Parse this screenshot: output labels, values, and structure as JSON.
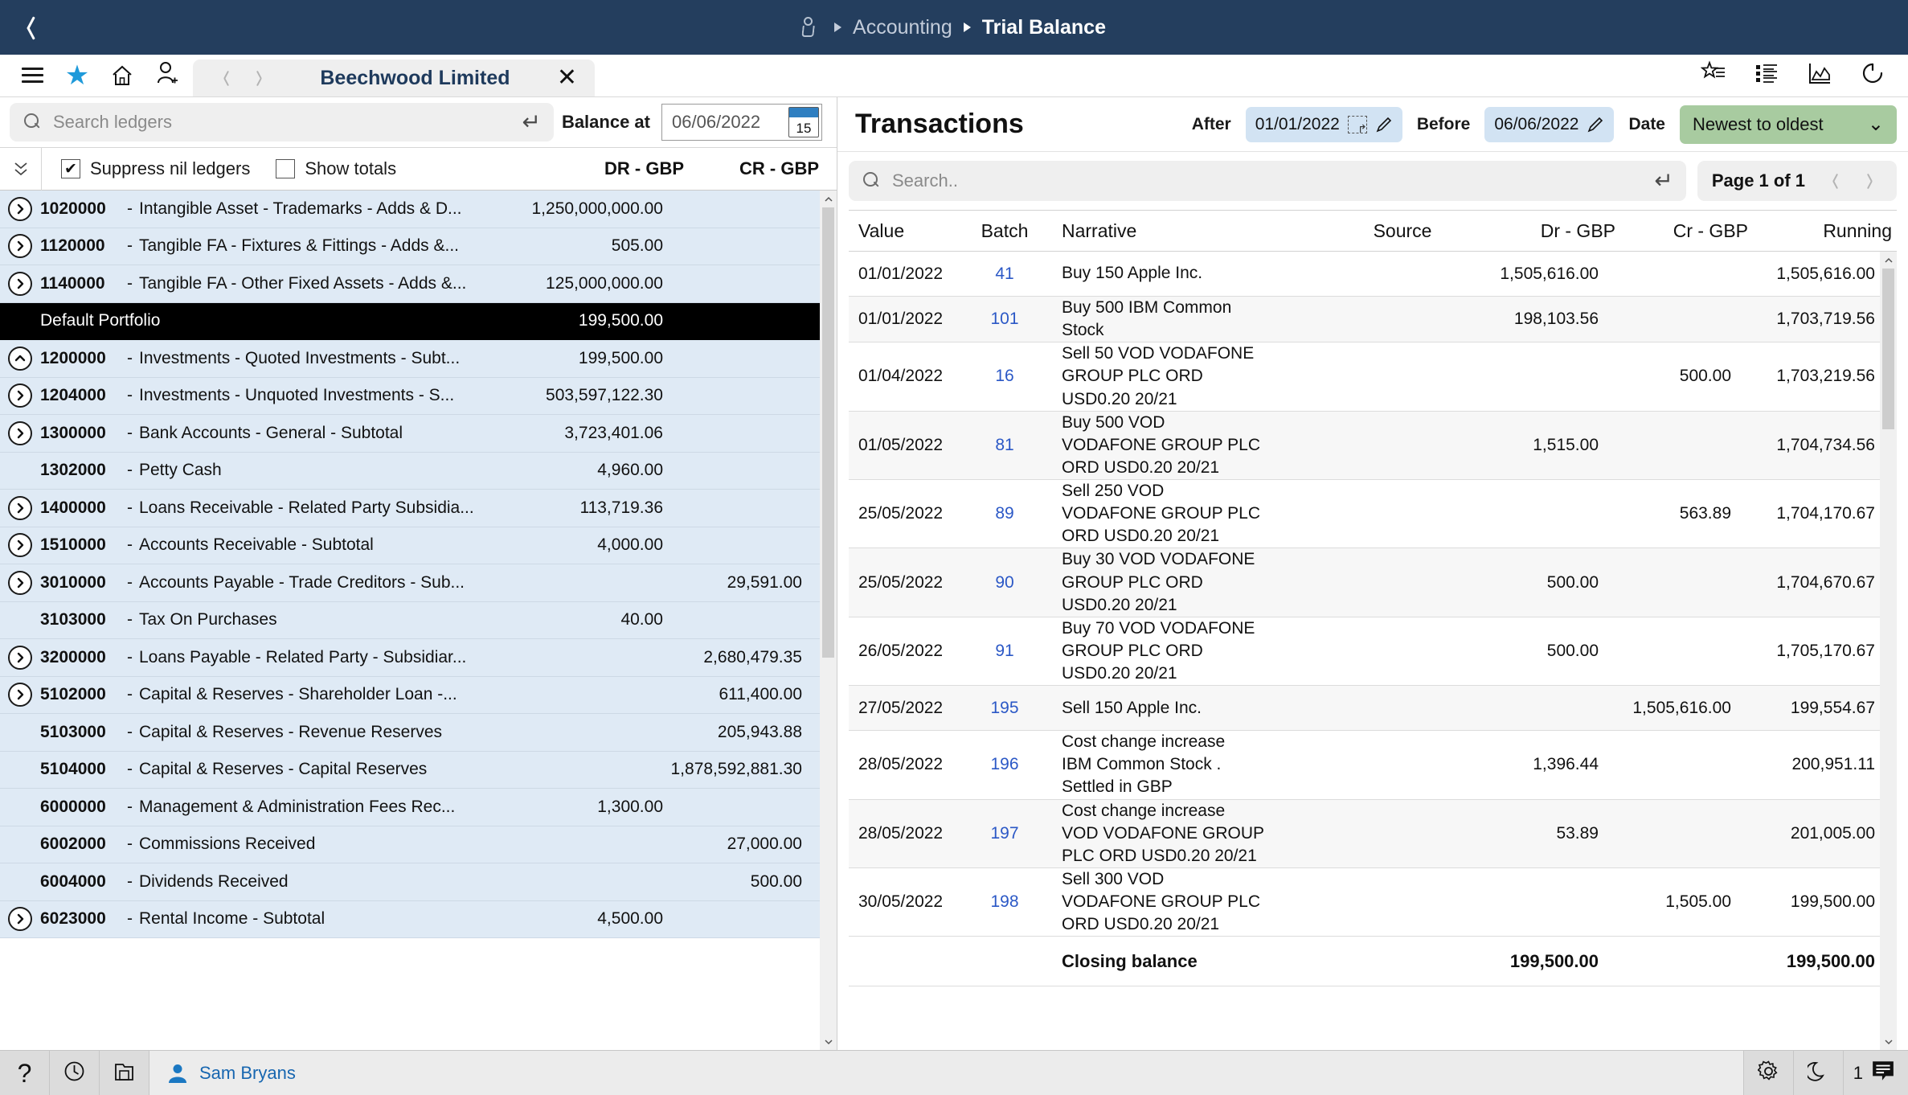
{
  "topbar": {
    "back_label": "back",
    "breadcrumb": {
      "user_icon": "user-network-icon",
      "module": "Accounting",
      "current": "Trial Balance"
    }
  },
  "toolbar": {
    "menu_icon": "hamburger-menu-icon",
    "favorites_icon": "star-icon",
    "home_icon": "home-icon",
    "add_user_icon": "add-user-icon",
    "tab": {
      "title": "Beechwood Limited",
      "prev_icon": "chevron-left-icon",
      "next_icon": "chevron-right-icon",
      "close_icon": "close-icon"
    },
    "right_icons": [
      {
        "name": "favourites-list-icon"
      },
      {
        "name": "list-view-icon"
      },
      {
        "name": "chart-icon"
      },
      {
        "name": "refresh-icon"
      }
    ]
  },
  "left_panel": {
    "search": {
      "placeholder": "Search ledgers",
      "value": "",
      "enter_icon": "enter-key-icon",
      "search_icon": "search-icon"
    },
    "balance_at": {
      "label": "Balance at",
      "value": "06/06/2022",
      "calendar_icon": "calendar-icon",
      "calendar_day": "15"
    },
    "collapse_all_icon": "double-chevron-down-icon",
    "options": [
      {
        "label": "Suppress nil ledgers",
        "checked": true
      },
      {
        "label": "Show totals",
        "checked": false
      }
    ],
    "columns": {
      "dr": "DR - GBP",
      "cr": "CR - GBP"
    },
    "ledgers": [
      {
        "code": "1020000",
        "dash": "-",
        "name": "Intangible Asset - Trademarks - Adds & D...",
        "dr": "1,250,000,000.00",
        "cr": "",
        "expandable": true,
        "expanded": false,
        "selected": false
      },
      {
        "code": "1120000",
        "dash": "-",
        "name": "Tangible FA - Fixtures & Fittings - Adds &...",
        "dr": "505.00",
        "cr": "",
        "expandable": true,
        "expanded": false,
        "selected": false
      },
      {
        "code": "1140000",
        "dash": "-",
        "name": "Tangible FA - Other Fixed Assets - Adds &...",
        "dr": "125,000,000.00",
        "cr": "",
        "expandable": true,
        "expanded": false,
        "selected": false
      },
      {
        "code": "",
        "dash": "",
        "name": "Default Portfolio",
        "dr": "199,500.00",
        "cr": "",
        "expandable": false,
        "expanded": false,
        "selected": true
      },
      {
        "code": "1200000",
        "dash": "-",
        "name": "Investments - Quoted Investments - Subt...",
        "dr": "199,500.00",
        "cr": "",
        "expandable": true,
        "expanded": true,
        "selected": false
      },
      {
        "code": "1204000",
        "dash": "-",
        "name": "Investments - Unquoted Investments - S...",
        "dr": "503,597,122.30",
        "cr": "",
        "expandable": true,
        "expanded": false,
        "selected": false
      },
      {
        "code": "1300000",
        "dash": "-",
        "name": "Bank Accounts - General - Subtotal",
        "dr": "3,723,401.06",
        "cr": "",
        "expandable": true,
        "expanded": false,
        "selected": false
      },
      {
        "code": "1302000",
        "dash": "-",
        "name": "Petty Cash",
        "dr": "4,960.00",
        "cr": "",
        "expandable": false,
        "expanded": false,
        "selected": false
      },
      {
        "code": "1400000",
        "dash": "-",
        "name": "Loans Receivable - Related Party Subsidia...",
        "dr": "113,719.36",
        "cr": "",
        "expandable": true,
        "expanded": false,
        "selected": false
      },
      {
        "code": "1510000",
        "dash": "-",
        "name": "Accounts Receivable - Subtotal",
        "dr": "4,000.00",
        "cr": "",
        "expandable": true,
        "expanded": false,
        "selected": false
      },
      {
        "code": "3010000",
        "dash": "-",
        "name": "Accounts Payable - Trade Creditors - Sub...",
        "dr": "",
        "cr": "29,591.00",
        "expandable": true,
        "expanded": false,
        "selected": false
      },
      {
        "code": "3103000",
        "dash": "-",
        "name": "Tax On Purchases",
        "dr": "40.00",
        "cr": "",
        "expandable": false,
        "expanded": false,
        "selected": false
      },
      {
        "code": "3200000",
        "dash": "-",
        "name": "Loans Payable - Related Party - Subsidiar...",
        "dr": "",
        "cr": "2,680,479.35",
        "expandable": true,
        "expanded": false,
        "selected": false
      },
      {
        "code": "5102000",
        "dash": "-",
        "name": "Capital & Reserves - Shareholder Loan -...",
        "dr": "",
        "cr": "611,400.00",
        "expandable": true,
        "expanded": false,
        "selected": false
      },
      {
        "code": "5103000",
        "dash": "-",
        "name": "Capital & Reserves - Revenue Reserves",
        "dr": "",
        "cr": "205,943.88",
        "expandable": false,
        "expanded": false,
        "selected": false
      },
      {
        "code": "5104000",
        "dash": "-",
        "name": "Capital & Reserves - Capital Reserves",
        "dr": "",
        "cr": "1,878,592,881.30",
        "expandable": false,
        "expanded": false,
        "selected": false
      },
      {
        "code": "6000000",
        "dash": "-",
        "name": "Management & Administration Fees Rec...",
        "dr": "1,300.00",
        "cr": "",
        "expandable": false,
        "expanded": false,
        "selected": false
      },
      {
        "code": "6002000",
        "dash": "-",
        "name": "Commissions Received",
        "dr": "",
        "cr": "27,000.00",
        "expandable": false,
        "expanded": false,
        "selected": false
      },
      {
        "code": "6004000",
        "dash": "-",
        "name": "Dividends Received",
        "dr": "",
        "cr": "500.00",
        "expandable": false,
        "expanded": false,
        "selected": false
      },
      {
        "code": "6023000",
        "dash": "-",
        "name": "Rental Income - Subtotal",
        "dr": "4,500.00",
        "cr": "",
        "expandable": true,
        "expanded": false,
        "selected": false
      }
    ]
  },
  "right_panel": {
    "title": "Transactions",
    "filters": {
      "after_label": "After",
      "after_value": "01/01/2022",
      "before_label": "Before",
      "before_value": "06/06/2022",
      "date_label": "Date",
      "sort_value": "Newest to oldest"
    },
    "search": {
      "placeholder": "Search..",
      "value": "",
      "search_icon": "search-icon",
      "enter_icon": "enter-key-icon"
    },
    "pager": {
      "label": "Page 1 of 1",
      "prev_icon": "chevron-left-icon",
      "next_icon": "chevron-right-icon"
    },
    "columns": [
      "Value",
      "Batch",
      "Narrative",
      "Source",
      "Dr - GBP",
      "Cr - GBP",
      "Running"
    ],
    "transactions": [
      {
        "value": "01/01/2022",
        "batch": "41",
        "narrative": "Buy 150 Apple Inc.",
        "source": "",
        "dr": "1,505,616.00",
        "cr": "",
        "running": "1,505,616.00"
      },
      {
        "value": "01/01/2022",
        "batch": "101",
        "narrative": "Buy 500 IBM Common\nStock",
        "source": "",
        "dr": "198,103.56",
        "cr": "",
        "running": "1,703,719.56"
      },
      {
        "value": "01/04/2022",
        "batch": "16",
        "narrative": "Sell 50 VOD VODAFONE\nGROUP PLC ORD\nUSD0.20 20/21",
        "source": "",
        "dr": "",
        "cr": "500.00",
        "running": "1,703,219.56"
      },
      {
        "value": "01/05/2022",
        "batch": "81",
        "narrative": "Buy 500 VOD\nVODAFONE GROUP PLC\nORD USD0.20 20/21",
        "source": "",
        "dr": "1,515.00",
        "cr": "",
        "running": "1,704,734.56"
      },
      {
        "value": "25/05/2022",
        "batch": "89",
        "narrative": "Sell 250 VOD\nVODAFONE GROUP PLC\nORD USD0.20 20/21",
        "source": "",
        "dr": "",
        "cr": "563.89",
        "running": "1,704,170.67"
      },
      {
        "value": "25/05/2022",
        "batch": "90",
        "narrative": "Buy 30 VOD VODAFONE\nGROUP PLC ORD\nUSD0.20 20/21",
        "source": "",
        "dr": "500.00",
        "cr": "",
        "running": "1,704,670.67"
      },
      {
        "value": "26/05/2022",
        "batch": "91",
        "narrative": "Buy 70 VOD VODAFONE\nGROUP PLC ORD\nUSD0.20 20/21",
        "source": "",
        "dr": "500.00",
        "cr": "",
        "running": "1,705,170.67"
      },
      {
        "value": "27/05/2022",
        "batch": "195",
        "narrative": "Sell 150 Apple Inc.",
        "source": "",
        "dr": "",
        "cr": "1,505,616.00",
        "running": "199,554.67"
      },
      {
        "value": "28/05/2022",
        "batch": "196",
        "narrative": "Cost change increase\nIBM Common Stock .\nSettled in GBP",
        "source": "",
        "dr": "1,396.44",
        "cr": "",
        "running": "200,951.11"
      },
      {
        "value": "28/05/2022",
        "batch": "197",
        "narrative": "Cost change increase\nVOD VODAFONE GROUP\nPLC ORD USD0.20 20/21",
        "source": "",
        "dr": "53.89",
        "cr": "",
        "running": "201,005.00"
      },
      {
        "value": "30/05/2022",
        "batch": "198",
        "narrative": "Sell 300 VOD\nVODAFONE GROUP PLC\nORD USD0.20 20/21",
        "source": "",
        "dr": "",
        "cr": "1,505.00",
        "running": "199,500.00"
      }
    ],
    "closing": {
      "label": "Closing balance",
      "dr": "199,500.00",
      "cr": "",
      "running": "199,500.00"
    }
  },
  "statusbar": {
    "help_icon": "help-question-icon",
    "history_icon": "clock-history-icon",
    "archive_icon": "archive-folder-icon",
    "user_icon": "user-avatar-icon",
    "user_name": "Sam Bryans",
    "settings_icon": "gear-icon",
    "theme_icon": "moon-icon",
    "notification_count": "1",
    "notification_icon": "message-icon"
  },
  "colors": {
    "topbar_bg": "#243e5e",
    "accent_blue": "#1f9ada",
    "ledger_row_bg": "#dfeaf5",
    "selected_row_bg": "#000000",
    "filter_chip_bg": "#d2e3f3",
    "sort_chip_bg": "#a8cba0",
    "batch_link": "#2b58c6",
    "statusbar_bg": "#dcdcdc"
  }
}
